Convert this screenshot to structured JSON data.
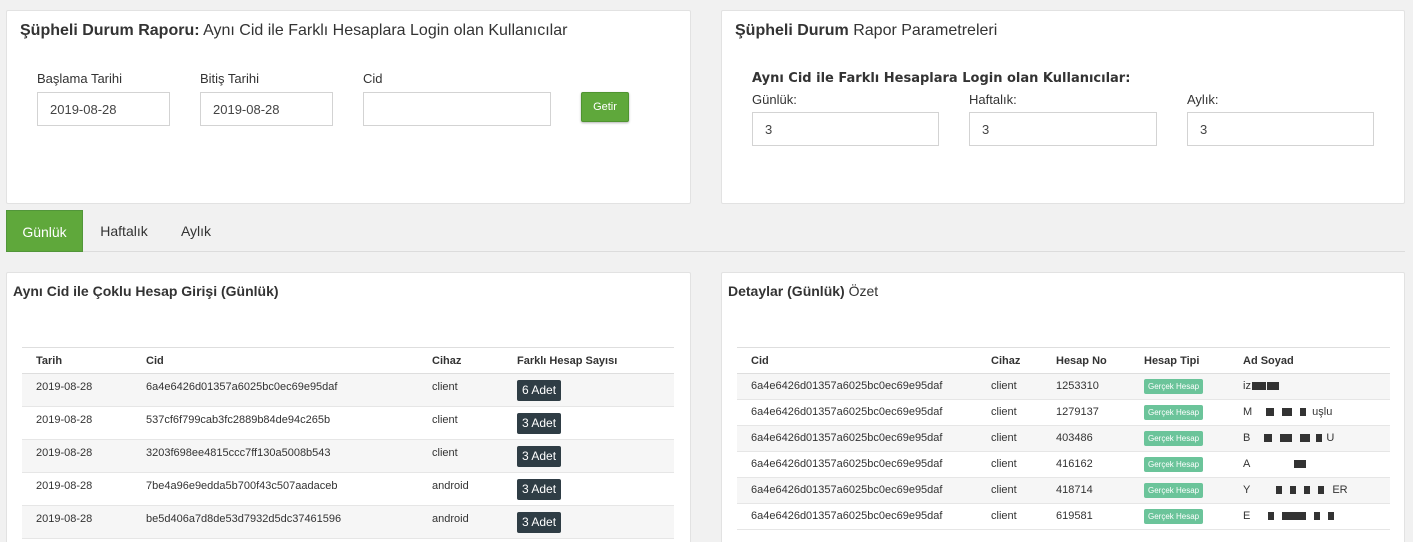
{
  "report_panel": {
    "title_bold": "Şüpheli Durum Raporu:",
    "title_rest": " Aynı Cid ile Farklı Hesaplara Login olan Kullanıcılar",
    "start_label": "Başlama Tarihi",
    "start_value": "2019-08-28",
    "end_label": "Bitiş Tarihi",
    "end_value": "2019-08-28",
    "cid_label": "Cid",
    "cid_value": "",
    "submit_label": "Getir"
  },
  "params_panel": {
    "title_bold": "Şüpheli Durum",
    "title_rest": " Rapor Parametreleri",
    "subtitle": "Aynı Cid ile Farklı Hesaplara Login olan Kullanıcılar:",
    "daily_label": "Günlük:",
    "daily_value": "3",
    "weekly_label": "Haftalık:",
    "weekly_value": "3",
    "monthly_label": "Aylık:",
    "monthly_value": "3"
  },
  "tabs": [
    {
      "label": "Günlük",
      "active": true
    },
    {
      "label": "Haftalık",
      "active": false
    },
    {
      "label": "Aylık",
      "active": false
    }
  ],
  "multi_login": {
    "title": "Aynı Cid ile Çoklu Hesap Girişi (Günlük)",
    "headers": [
      "Tarih",
      "Cid",
      "Cihaz",
      "Farklı Hesap Sayısı"
    ],
    "rows": [
      [
        "2019-08-28",
        "6a4e6426d01357a6025bc0ec69e95daf",
        "client",
        "6 Adet"
      ],
      [
        "2019-08-28",
        "537cf6f799cab3fc2889b84de94c265b",
        "client",
        "3 Adet"
      ],
      [
        "2019-08-28",
        "3203f698ee4815ccc7ff130a5008b543",
        "client",
        "3 Adet"
      ],
      [
        "2019-08-28",
        "7be4a96e9edda5b700f43c507aadaceb",
        "android",
        "3 Adet"
      ],
      [
        "2019-08-28",
        "be5d406a7d8de53d7932d5dc37461596",
        "android",
        "3 Adet"
      ]
    ]
  },
  "details": {
    "title_bold": "Detaylar (Günlük)",
    "title_rest": " Özet",
    "headers": [
      "Cid",
      "Cihaz",
      "Hesap No",
      "Hesap Tipi",
      "Ad Soyad"
    ],
    "rows": [
      [
        "6a4e6426d01357a6025bc0ec69e95daf",
        "client",
        "1253310",
        "Gerçek Hesap",
        "iz"
      ],
      [
        "6a4e6426d01357a6025bc0ec69e95daf",
        "client",
        "1279137",
        "Gerçek Hesap",
        "M"
      ],
      [
        "6a4e6426d01357a6025bc0ec69e95daf",
        "client",
        "403486",
        "Gerçek Hesap",
        "B"
      ],
      [
        "6a4e6426d01357a6025bc0ec69e95daf",
        "client",
        "416162",
        "Gerçek Hesap",
        "A"
      ],
      [
        "6a4e6426d01357a6025bc0ec69e95daf",
        "client",
        "418714",
        "Gerçek Hesap",
        "Y"
      ],
      [
        "6a4e6426d01357a6025bc0ec69e95daf",
        "client",
        "619581",
        "Gerçek Hesap",
        "E"
      ]
    ],
    "name_suffixes": [
      "",
      "uşlu",
      "U",
      "",
      "ER",
      ""
    ]
  },
  "colors": {
    "accent_green": "#5fa83b",
    "badge_dark": "#2f3d45",
    "badge_green": "#6bc49a"
  }
}
